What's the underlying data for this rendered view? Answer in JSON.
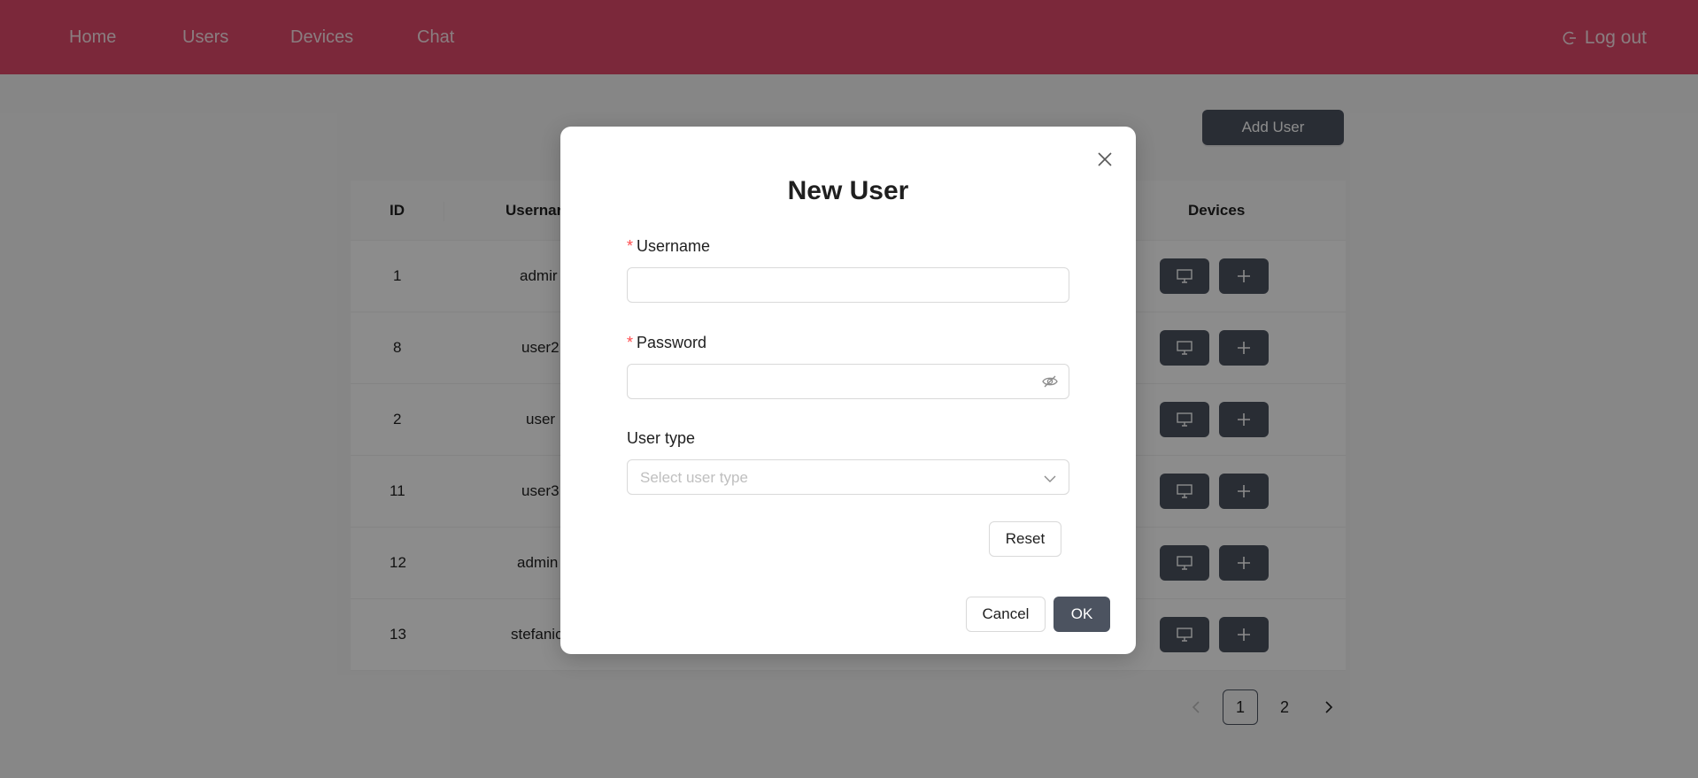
{
  "nav": {
    "items": [
      {
        "label": "Home"
      },
      {
        "label": "Users"
      },
      {
        "label": "Devices"
      },
      {
        "label": "Chat"
      }
    ],
    "logout_label": "Log out"
  },
  "page": {
    "add_user_label": "Add User"
  },
  "table": {
    "headers": {
      "id": "ID",
      "username": "Usernar",
      "devices": "Devices"
    },
    "rows": [
      {
        "id": "1",
        "username": "admir"
      },
      {
        "id": "8",
        "username": "user2"
      },
      {
        "id": "2",
        "username": "user"
      },
      {
        "id": "11",
        "username": "user3"
      },
      {
        "id": "12",
        "username": "admin"
      },
      {
        "id": "13",
        "username": "stefanic"
      }
    ]
  },
  "pagination": {
    "pages": [
      "1",
      "2"
    ],
    "current": "1"
  },
  "modal": {
    "title": "New User",
    "username_label": "Username",
    "password_label": "Password",
    "user_type_label": "User type",
    "user_type_placeholder": "Select user type",
    "reset_label": "Reset",
    "cancel_label": "Cancel",
    "ok_label": "OK"
  },
  "colors": {
    "navbar": "#e0496a",
    "primary_button": "#4c5360",
    "required": "#ff4d4f"
  }
}
